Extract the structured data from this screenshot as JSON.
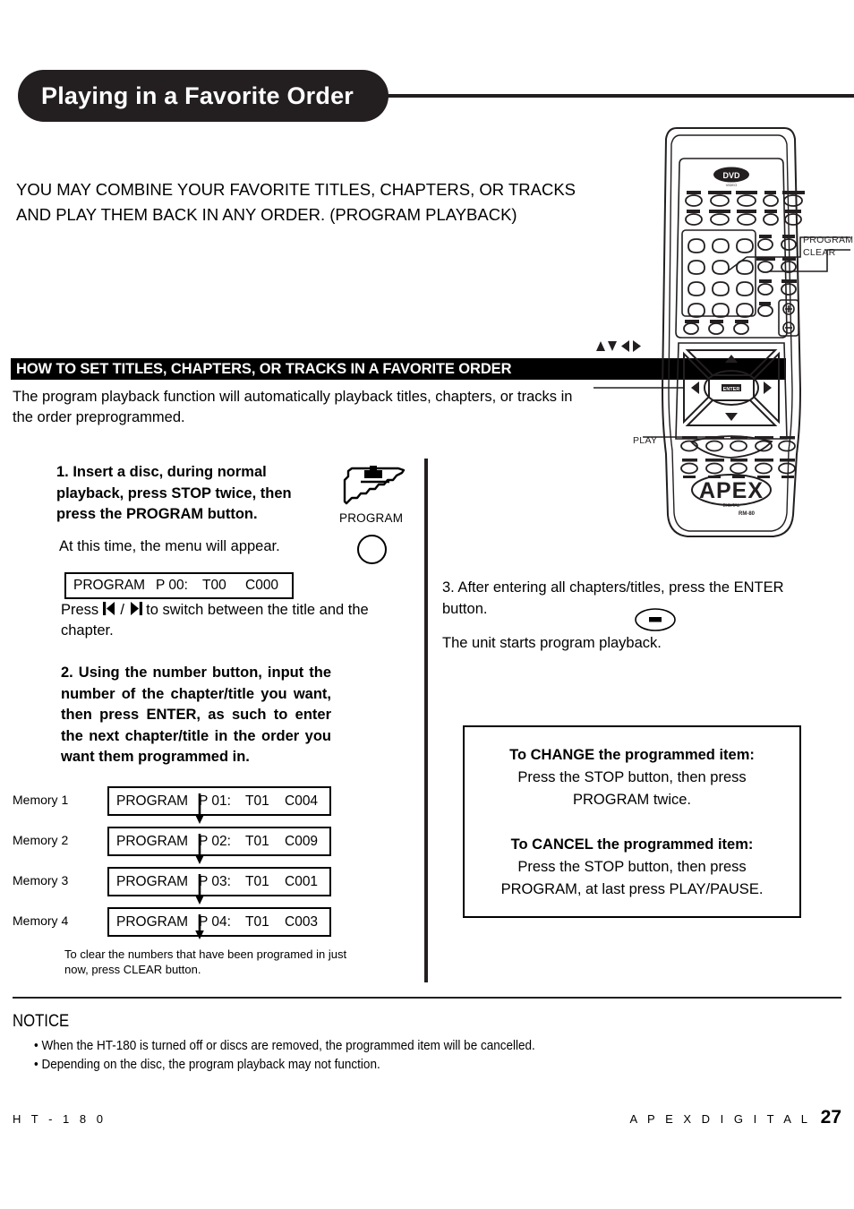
{
  "header": {
    "title": "Playing in a Favorite Order"
  },
  "intro": {
    "line1": "YOU MAY COMBINE YOUR FAVORITE TITLES, CHAPTERS, OR TRACKS",
    "line2": "AND PLAY THEM BACK IN ANY ORDER. (PROGRAM PLAYBACK)"
  },
  "section": {
    "bar_title": "HOW TO SET TITLES, CHAPTERS, OR TRACKS IN A FAVORITE ORDER",
    "subtitle": "The program playback function will automatically playback titles, chapters, or tracks in the order preprogrammed."
  },
  "left_column": {
    "step1": "1. Insert a disc, during normal playback, press STOP twice, then press the PROGRAM button.",
    "step1_note": "At this time, the menu will appear.",
    "program_icon_label": "PROGRAM",
    "display": {
      "label": "PROGRAM",
      "p": "P 00:",
      "t": "T00",
      "c": "C000"
    },
    "press_prefix": "Press",
    "press_sep": "/",
    "press_suffix": "to switch between the title and the chapter.",
    "step2": "2. Using the number button, input the number of the chapter/title you want, then press ENTER, as such to enter the next chapter/title in the order you want them programmed in.",
    "memories": [
      {
        "label": "Memory 1",
        "program": "PROGRAM",
        "p": "P 01:",
        "t": "T01",
        "c": "C004"
      },
      {
        "label": "Memory 2",
        "program": "PROGRAM",
        "p": "P 02:",
        "t": "T01",
        "c": "C009"
      },
      {
        "label": "Memory 3",
        "program": "PROGRAM",
        "p": "P 03:",
        "t": "T01",
        "c": "C001"
      },
      {
        "label": "Memory 4",
        "program": "PROGRAM",
        "p": "P 04:",
        "t": "T01",
        "c": "C003"
      }
    ],
    "memory_note": "To clear the numbers that have been programed in just now, press CLEAR button."
  },
  "right_column": {
    "step3": "3. After entering all chapters/titles, press the ENTER button.",
    "step3_result": "The unit starts program playback.",
    "enter_button_label": "ENTER",
    "callout_box": {
      "change_heading": "To CHANGE the programmed item:",
      "change_body_line1": "Press the STOP button, then press",
      "change_body_line2": "PROGRAM twice.",
      "cancel_heading": "To CANCEL the programmed item:",
      "cancel_body_line1": "Press the STOP button, then press",
      "cancel_body_line2": "PROGRAM, at last press PLAY/PAUSE."
    }
  },
  "remote": {
    "callout_program": "PROGRAM",
    "callout_clear": "CLEAR",
    "callout_play": "PLAY",
    "center_button": "ENTER",
    "brand": "APEX",
    "logo_top": "DVD",
    "logo_sub": "VIDEO"
  },
  "notice": {
    "title": "NOTICE",
    "items": [
      "• When the HT-180 is turned off or discs are removed, the programmed item will be cancelled.",
      "• Depending on the disc, the program playback may not function."
    ]
  },
  "footer": {
    "model": "H T - 1 8 0",
    "brand": "A P E X   D I G I T A L",
    "page": "27"
  },
  "colors": {
    "ink": "#231f20",
    "bar": "#000000",
    "paper": "#ffffff"
  }
}
